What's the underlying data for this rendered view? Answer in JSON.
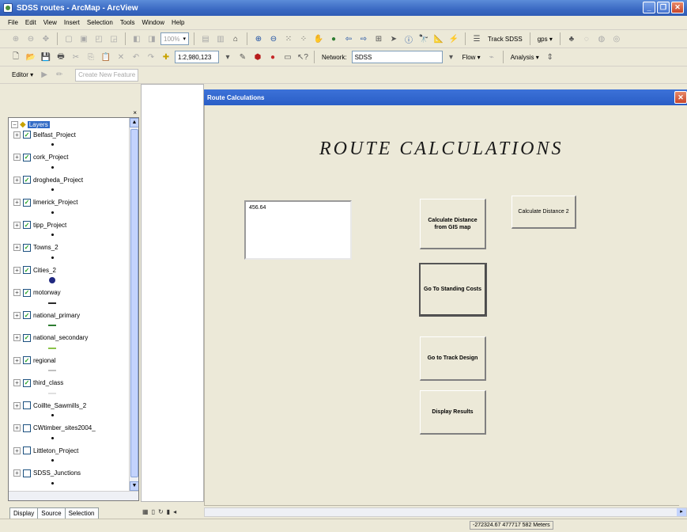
{
  "window": {
    "title": "SDSS routes - ArcMap - ArcView",
    "minimize_glyph": "_",
    "maximize_glyph": "❐",
    "close_glyph": "✕"
  },
  "menu": [
    "File",
    "Edit",
    "View",
    "Insert",
    "Selection",
    "Tools",
    "Window",
    "Help"
  ],
  "toolbar_top": {
    "track_label": "Track SDSS",
    "gps_label": "gps ▾",
    "scale_combo": "100%"
  },
  "toolbar_std": {
    "scale_value": "1:2,980,123",
    "network_label": "Network:",
    "network_value": "SDSS",
    "flow_label": "Flow ▾",
    "analysis_label": "Analysis ▾"
  },
  "toolbar_editor": {
    "editor_label": "Editor ▾",
    "task_combo": "Create New Feature"
  },
  "toc": {
    "root_label": "Layers",
    "layers": [
      {
        "name": "Belfast_Project",
        "checked": true,
        "symbol": "dot"
      },
      {
        "name": "cork_Project",
        "checked": true,
        "symbol": "dot"
      },
      {
        "name": "drogheda_Project",
        "checked": true,
        "symbol": "dot"
      },
      {
        "name": "limerick_Project",
        "checked": true,
        "symbol": "dot"
      },
      {
        "name": "tipp_Project",
        "checked": true,
        "symbol": "dot"
      },
      {
        "name": "Towns_2",
        "checked": true,
        "symbol": "dot"
      },
      {
        "name": "Cities_2",
        "checked": true,
        "symbol": "circle"
      },
      {
        "name": "motorway",
        "checked": true,
        "symbol": "line",
        "color": "#2a2a2a"
      },
      {
        "name": "national_primary",
        "checked": true,
        "symbol": "line",
        "color": "#2e7d32"
      },
      {
        "name": "national_secondary",
        "checked": true,
        "symbol": "line",
        "color": "#8bc34a"
      },
      {
        "name": "regional",
        "checked": true,
        "symbol": "line",
        "color": "#c0c0c0"
      },
      {
        "name": "third_class",
        "checked": true,
        "symbol": "line",
        "color": "#e0e0e0"
      },
      {
        "name": "Coillte_Sawmills_2",
        "checked": false,
        "symbol": "dot"
      },
      {
        "name": "CWtimber_sites2004_",
        "checked": false,
        "symbol": "dot"
      },
      {
        "name": "Littleton_Project",
        "checked": false,
        "symbol": "dot"
      },
      {
        "name": "SDSS_Junctions",
        "checked": false,
        "symbol": "dot"
      }
    ],
    "tabs": [
      "Display",
      "Source",
      "Selection"
    ]
  },
  "dialog": {
    "title": "Route Calculations",
    "heading": "ROUTE CALCULATIONS",
    "distance_value": "456.64",
    "buttons": {
      "calc_gis": "Calculate Distance from GIS map",
      "calc_2": "Calculate Distance 2",
      "standing_costs": "Go To Standing Costs",
      "track_design": "Go to Track Design",
      "display_results": "Display Results"
    }
  },
  "status": {
    "coordinates": "-272324.67  477717 582 Meters"
  }
}
